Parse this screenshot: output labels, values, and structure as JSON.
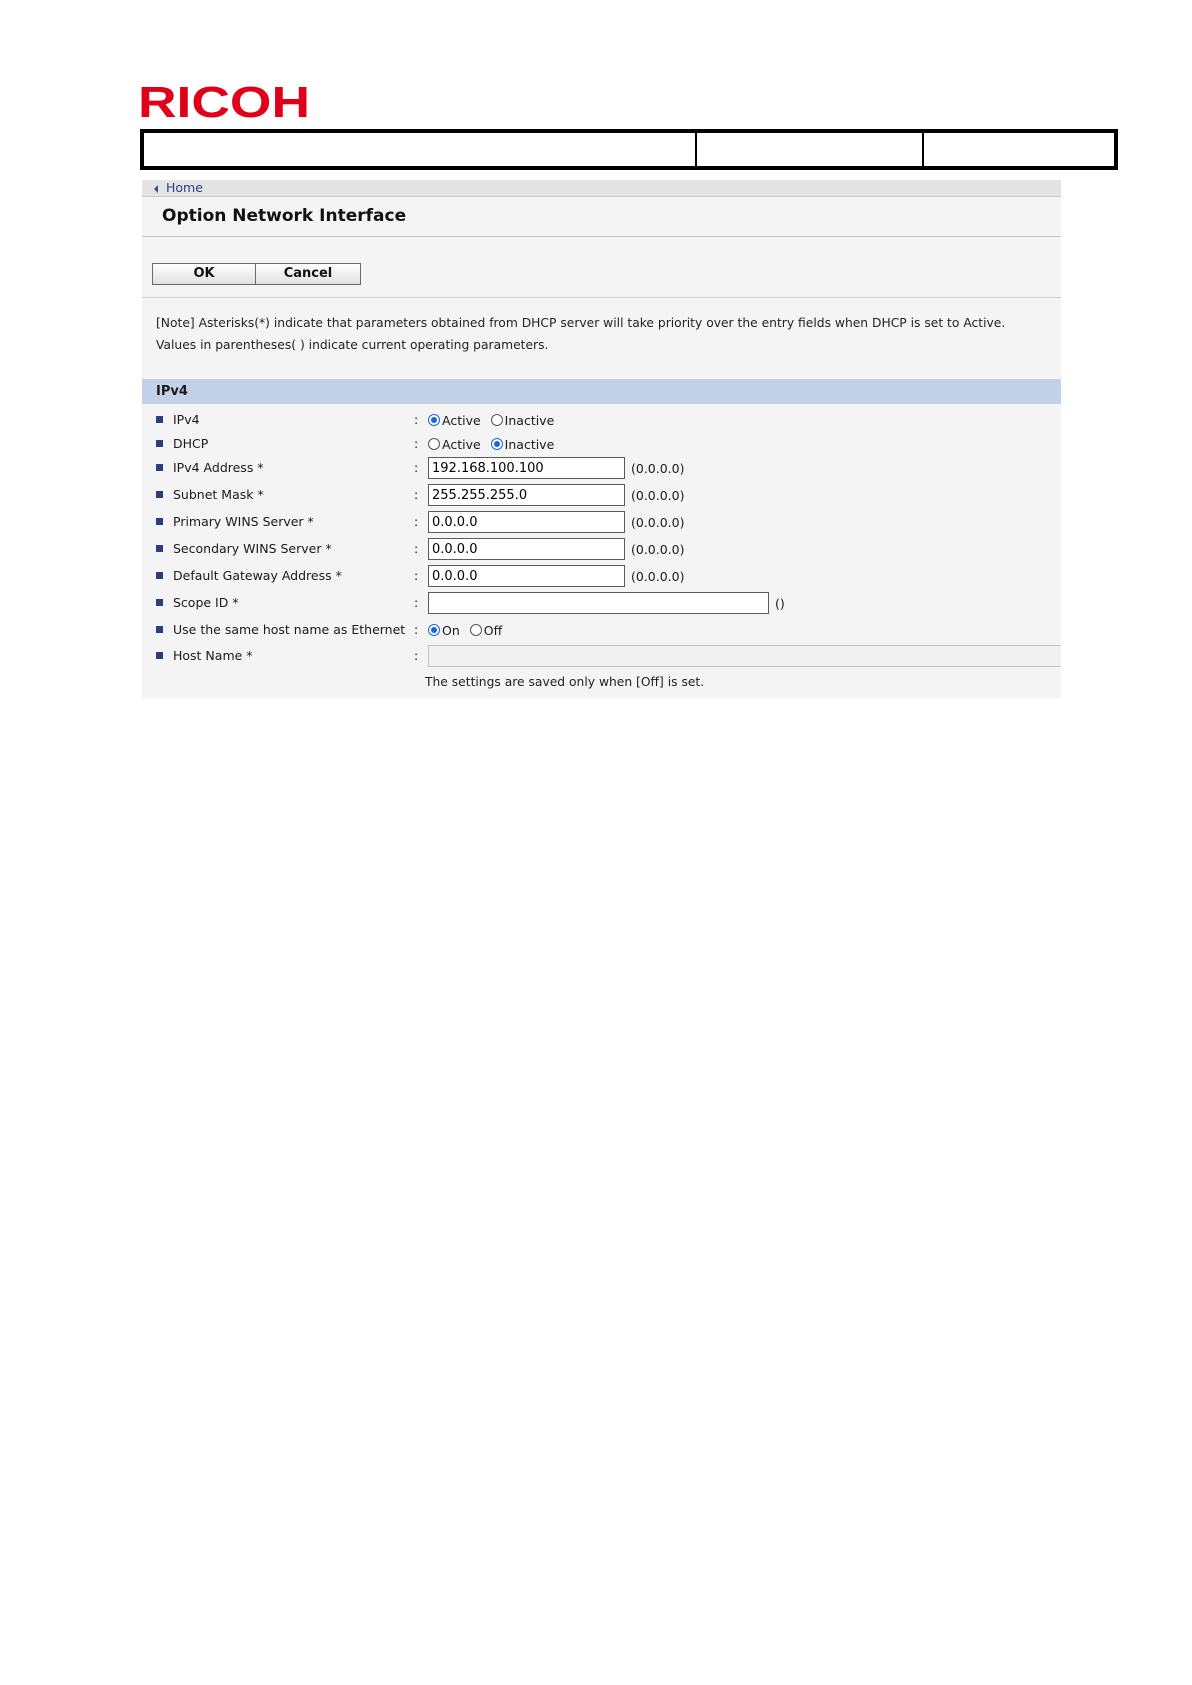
{
  "brand": {
    "logo_text": "RICOH",
    "logo_color": "#e1001a"
  },
  "breadcrumb": {
    "home_label": "Home"
  },
  "page": {
    "title": "Option Network Interface"
  },
  "toolbar": {
    "ok_label": "OK",
    "cancel_label": "Cancel"
  },
  "note": {
    "line1": "[Note] Asterisks(*) indicate that parameters obtained from DHCP server will take priority over the entry fields when DHCP is set to Active.",
    "line2": "Values in parentheses( ) indicate current operating parameters."
  },
  "section": {
    "title": "IPv4",
    "header_color": "#c2d0e8"
  },
  "form": {
    "ipv4": {
      "label": "IPv4",
      "active_label": "Active",
      "inactive_label": "Inactive",
      "selected": "Active"
    },
    "dhcp": {
      "label": "DHCP",
      "active_label": "Active",
      "inactive_label": "Inactive",
      "selected": "Inactive"
    },
    "ipv4_address": {
      "label": "IPv4 Address *",
      "value": "192.168.100.100",
      "current": "(0.0.0.0)"
    },
    "subnet_mask": {
      "label": "Subnet Mask *",
      "value": "255.255.255.0",
      "current": "(0.0.0.0)"
    },
    "primary_wins": {
      "label": "Primary WINS Server *",
      "value": "0.0.0.0",
      "current": "(0.0.0.0)"
    },
    "secondary_wins": {
      "label": "Secondary WINS Server *",
      "value": "0.0.0.0",
      "current": "(0.0.0.0)"
    },
    "default_gateway": {
      "label": "Default Gateway Address *",
      "value": "0.0.0.0",
      "current": "(0.0.0.0)"
    },
    "scope_id": {
      "label": "Scope ID *",
      "value": "",
      "current": "()"
    },
    "same_host_name": {
      "label": "Use the same host name as Ethernet",
      "on_label": "On",
      "off_label": "Off",
      "selected": "On"
    },
    "host_name": {
      "label": "Host Name *",
      "value": "",
      "hint": "The settings are saved only when [Off] is set."
    },
    "colon": ":"
  }
}
